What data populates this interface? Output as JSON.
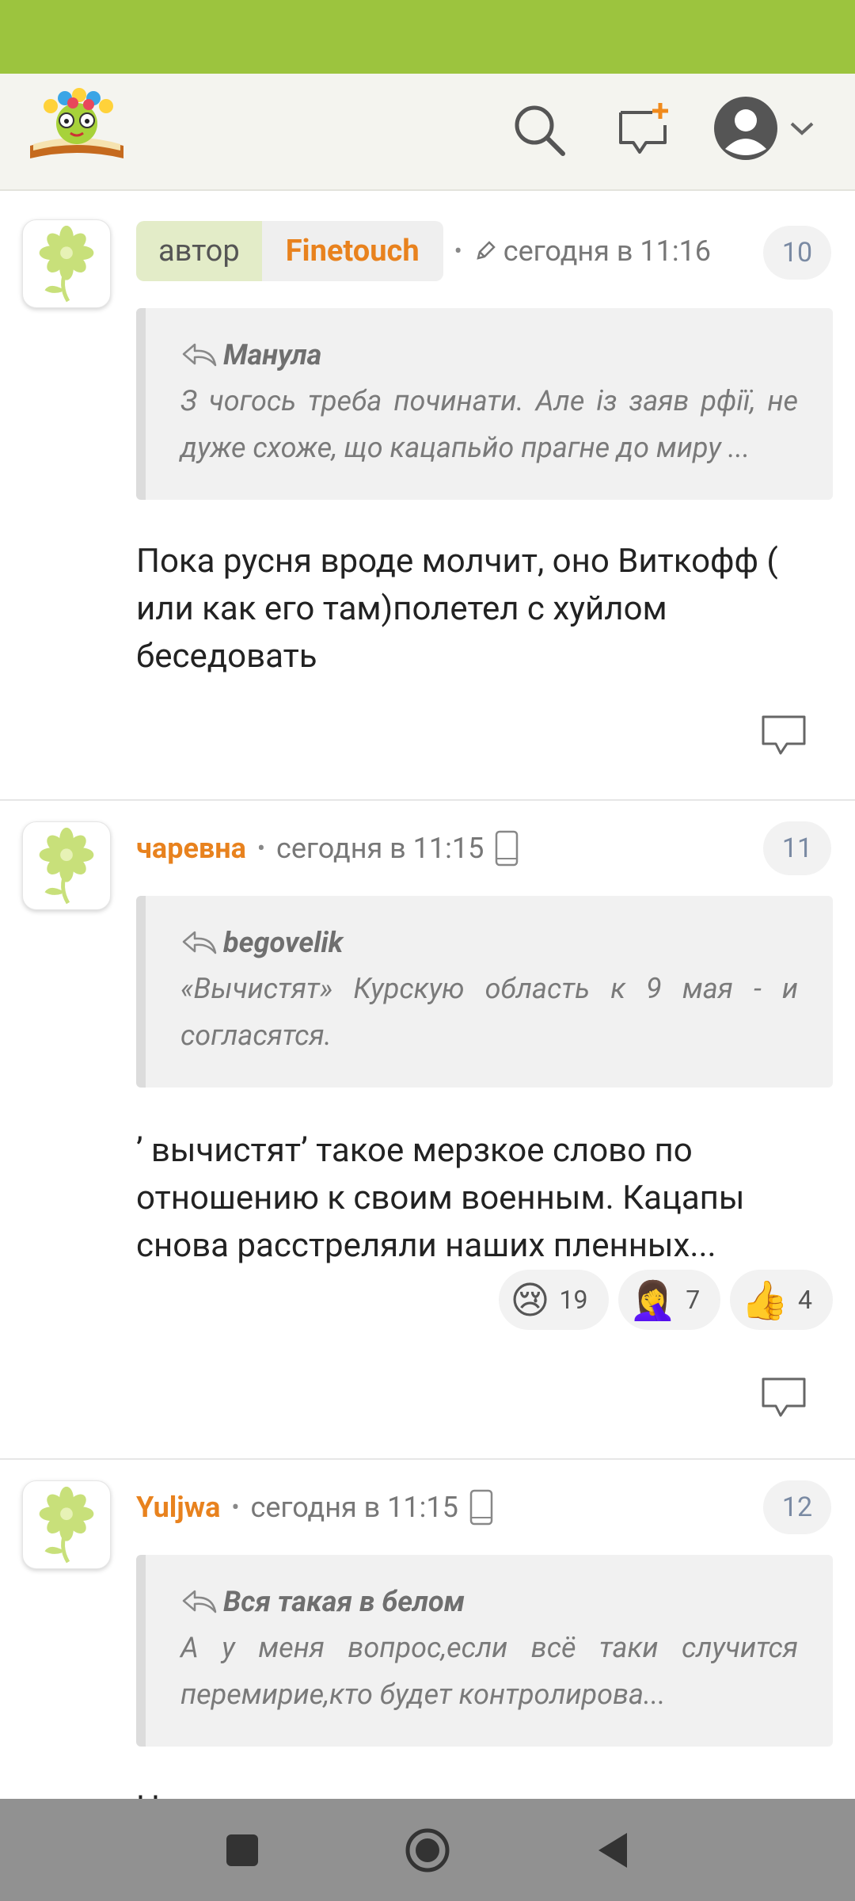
{
  "header": {
    "logo": "site-logo",
    "icons": [
      "search-icon",
      "new-post-icon",
      "user-avatar-icon",
      "chevron-down-icon"
    ]
  },
  "comments": [
    {
      "number": "10",
      "author_label": "автор",
      "username": "Finetouch",
      "time": "сегодня в 11:16",
      "quote_author": "Манула",
      "quote_text": "З чогось треба починати. Але із заяв рфії, не дуже схоже, що кацапьйо прагне до миру ...",
      "text": "Пока русня вроде молчит, оно Виткофф ( или как его там)полетел с хуйлом беседовать"
    },
    {
      "number": "11",
      "username": "чаревна",
      "time": "сегодня в 11:15",
      "quote_author": "begovelik",
      "quote_text": "«Вычистят» Курскую область к 9 мая - и согласятся.",
      "text": "’ вычистят’ такое мерзкое слово по отношению к своим военным. Кацапы снова расстреляли наших пленных...",
      "reactions": [
        {
          "emoji": "😢",
          "count": "19"
        },
        {
          "emoji": "🤦‍♀️",
          "count": "7"
        },
        {
          "emoji": "👍",
          "count": "4"
        }
      ]
    },
    {
      "number": "12",
      "username": "Yuljwa",
      "time": "сегодня в 11:15",
      "quote_author": "Вся такая в белом",
      "quote_text": "А у меня вопрос,если всё таки случится перемирие,кто будет контролирова...",
      "text": "Н"
    }
  ],
  "navbar": {
    "icons": [
      "recent-apps-icon",
      "home-icon",
      "back-icon"
    ]
  }
}
